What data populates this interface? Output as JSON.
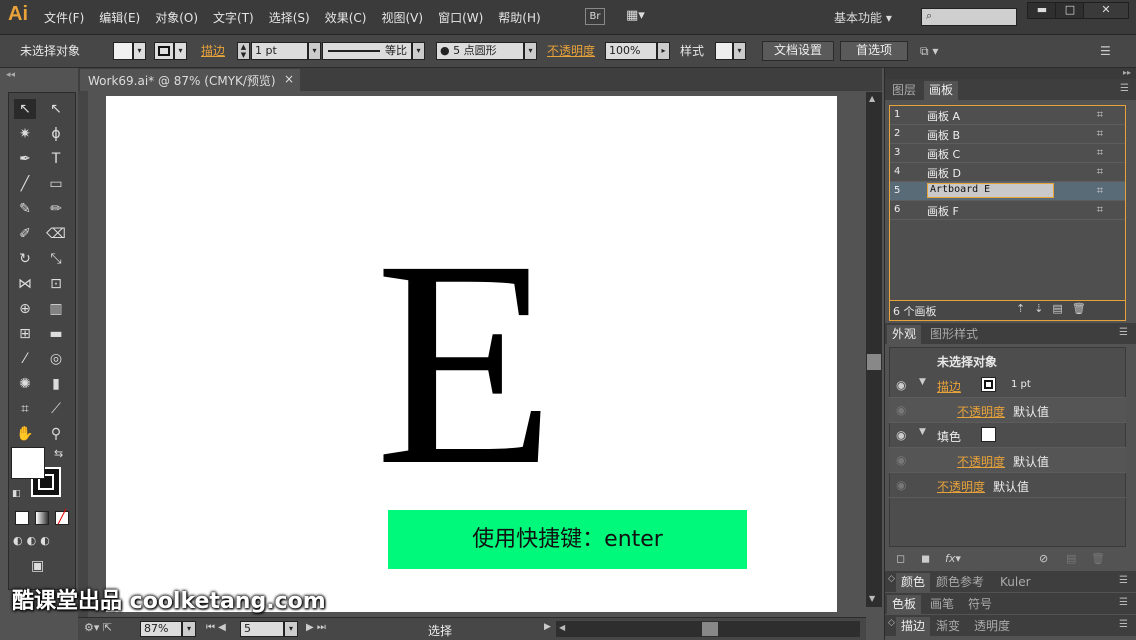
{
  "app": {
    "logo": "Ai",
    "menu": [
      "文件(F)",
      "编辑(E)",
      "对象(O)",
      "文字(T)",
      "选择(S)",
      "效果(C)",
      "视图(V)",
      "窗口(W)",
      "帮助(H)"
    ],
    "bridge": "Br",
    "workspace": "基本功能"
  },
  "control": {
    "selection": "未选择对象",
    "stroke_label": "描边",
    "stroke_weight": "1 pt",
    "profile": "等比",
    "brush": "5 点圆形",
    "opacity_label": "不透明度",
    "opacity": "100%",
    "style_label": "样式",
    "doc_setup": "文档设置",
    "preferences": "首选项"
  },
  "document": {
    "tab": "Work69.ai* @ 87% (CMYK/预览)",
    "close": "×"
  },
  "canvas": {
    "letter": "E",
    "shortcut": "使用快捷键：enter",
    "watermark": "酷课堂出品 coolketang.com"
  },
  "status": {
    "zoom": "87%",
    "artboard": "5",
    "tool": "选择"
  },
  "artboards_panel": {
    "tabs": [
      "图层",
      "画板"
    ],
    "items": [
      {
        "n": "1",
        "name": "画板 A"
      },
      {
        "n": "2",
        "name": "画板 B"
      },
      {
        "n": "3",
        "name": "画板 C"
      },
      {
        "n": "4",
        "name": "画板 D"
      },
      {
        "n": "5",
        "name": "Artboard E"
      },
      {
        "n": "6",
        "name": "画板 F"
      }
    ],
    "count": "6 个画板"
  },
  "appearance_panel": {
    "tabs": [
      "外观",
      "图形样式"
    ],
    "title": "未选择对象",
    "stroke_label": "描边",
    "stroke_value": "1 pt",
    "opacity_label": "不透明度",
    "default": "默认值",
    "fill_label": "填色"
  },
  "collapsed_panels": [
    [
      "颜色",
      "颜色参考",
      "Kuler"
    ],
    [
      "色板",
      "画笔",
      "符号"
    ],
    [
      "描边",
      "渐变",
      "透明度"
    ]
  ],
  "colors": {
    "accent": "#e8a23a",
    "shortcut_bg": "#00f97a",
    "selected_row": "#5a6b78"
  }
}
